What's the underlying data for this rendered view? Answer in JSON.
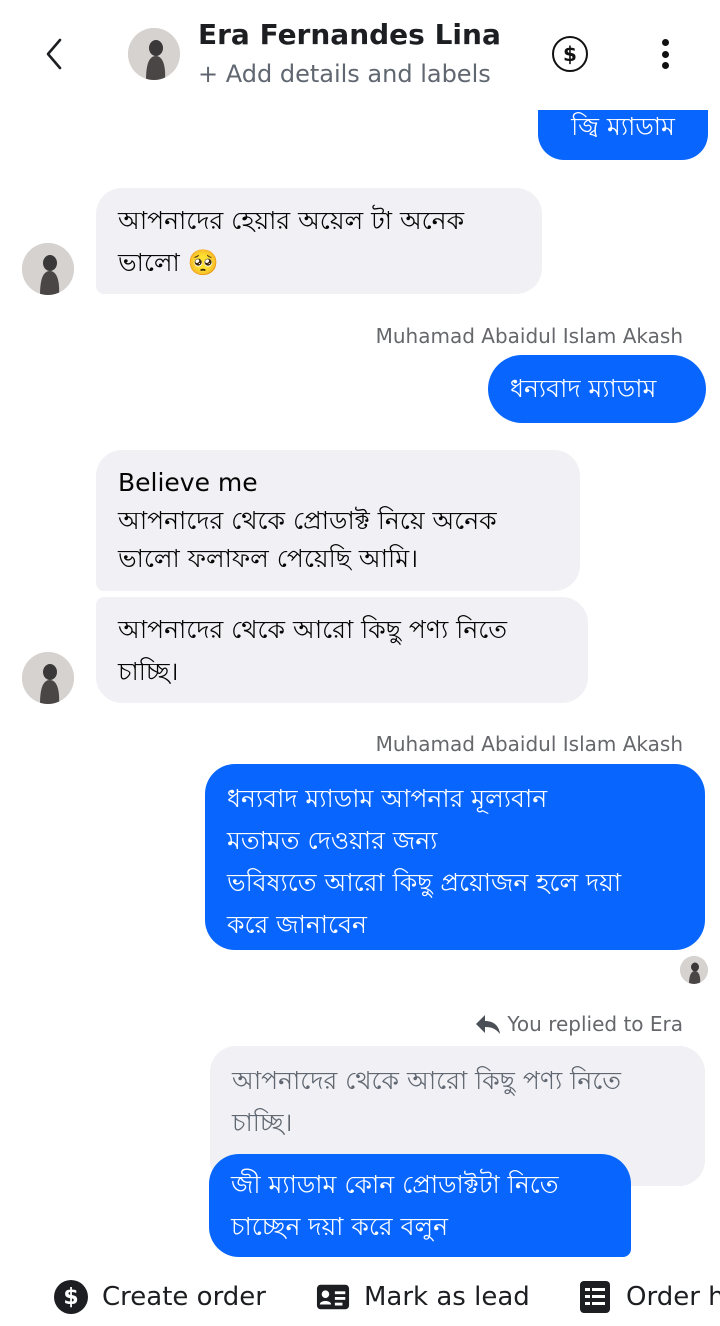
{
  "header": {
    "contact_name": "Era Fernandes Lina",
    "subtitle": "+ Add details and labels",
    "back_icon": "chevron-left-icon",
    "dollar_icon": "dollar-circle-icon",
    "more_icon": "more-vertical-icon"
  },
  "messages": {
    "m0_text": "জ্বি ম্যাডাম",
    "m1_text": "আপনাদের হেয়ার অয়েল টা অনেক\nভালো 🥺",
    "sender1": "Muhamad Abaidul Islam Akash",
    "m2_text": "ধন্যবাদ ম্যাডাম",
    "m3_text": "Believe me\nআপনাদের থেকে প্রোডাক্ট নিয়ে অনেক\nভালো ফলাফল পেয়েছি আমি।",
    "m4_text": "আপনাদের থেকে আরো কিছু পণ্য নিতে\nচাচ্ছি।",
    "sender2": "Muhamad Abaidul Islam Akash",
    "m5_text": "ধন্যবাদ ম্যাডাম আপনার মূল্যবান\nমতামত দেওয়ার জন্য\nভবিষ্যতে আরো কিছু প্রয়োজন হলে দয়া\nকরে জানাবেন",
    "reply_label": "You replied to Era",
    "quoted_text": "আপনাদের থেকে আরো কিছু পণ্য নিতে\nচাচ্ছি।",
    "m6_text": "জী ম্যাডাম কোন প্রোডাক্টটা নিতে\nচাচ্ছেন দয়া করে বলুন"
  },
  "actions": {
    "create_order": "Create order",
    "mark_as_lead": "Mark as lead",
    "order_history": "Order h"
  },
  "colors": {
    "outgoing_bubble": "#0866ff",
    "incoming_bubble": "#f0f0f5",
    "secondary_text": "#65676b"
  }
}
